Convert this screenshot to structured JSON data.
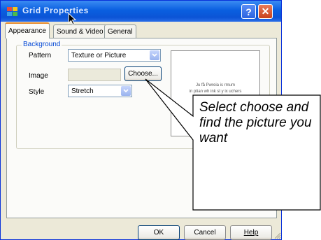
{
  "window": {
    "title": "Grid Properties"
  },
  "tabs": [
    {
      "label": "Appearance",
      "active": true
    },
    {
      "label": "Sound & Video",
      "active": false
    },
    {
      "label": "General",
      "active": false
    }
  ],
  "background": {
    "group_title": "Background",
    "pattern_label": "Pattern",
    "pattern_value": "Texture or Picture",
    "image_label": "Image",
    "image_value": "",
    "choose_button": "Choose...",
    "style_label": "Style",
    "style_value": "Stretch"
  },
  "preview": {
    "line1": "Ju få Pwreia is rmum",
    "line2": "in ptian wh ink st y ix uchers"
  },
  "buttons": {
    "ok": "OK",
    "cancel": "Cancel",
    "help": "Help"
  },
  "callout": {
    "text": "Select choose and find the picture you want"
  },
  "colors": {
    "titlebar": "#0b54d6",
    "accent": "#0046d5",
    "tab_highlight": "#e68b2c"
  },
  "icons": [
    "app-icon",
    "help-icon",
    "close-icon",
    "dropdown-arrow-icon",
    "cursor-icon",
    "resize-grip-icon"
  ]
}
